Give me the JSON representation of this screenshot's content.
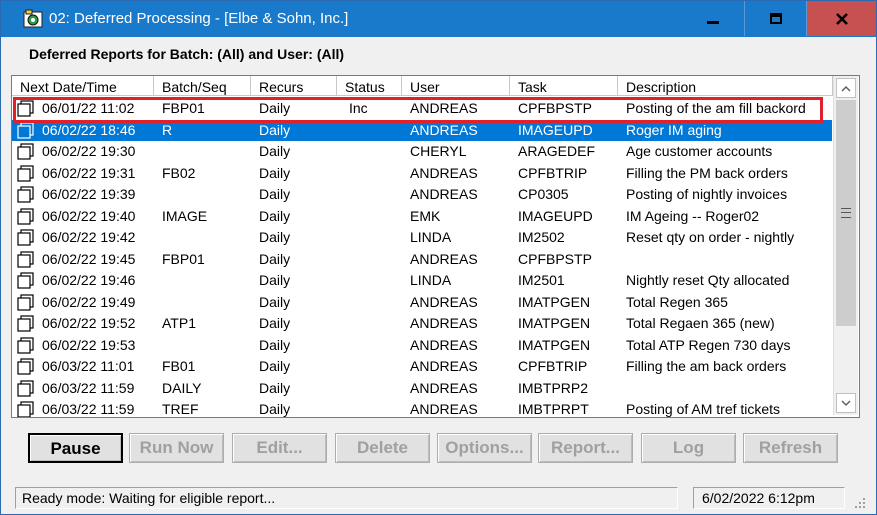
{
  "window": {
    "title": "02: Deferred Processing - [Elbe & Sohn, Inc.]",
    "header_label": "Deferred Reports for Batch:  (All) and User: (All)"
  },
  "columns": [
    "Next Date/Time",
    "Batch/Seq",
    "Recurs",
    "Status",
    "User",
    "Task",
    "Description"
  ],
  "rows": [
    {
      "datetime": "06/01/22 11:02",
      "batch": "FBP01",
      "recurs": "Daily",
      "status": "Inc",
      "user": "ANDREAS",
      "task": "CPFBPSTP",
      "description": "Posting of the am fill backord"
    },
    {
      "datetime": "06/02/22 18:46",
      "batch": "R",
      "recurs": "Daily",
      "status": "",
      "user": "ANDREAS",
      "task": "IMAGEUPD",
      "description": "Roger IM aging"
    },
    {
      "datetime": "06/02/22 19:30",
      "batch": "",
      "recurs": "Daily",
      "status": "",
      "user": "CHERYL",
      "task": "ARAGEDEF",
      "description": "Age customer accounts"
    },
    {
      "datetime": "06/02/22 19:31",
      "batch": "FB02",
      "recurs": "Daily",
      "status": "",
      "user": "ANDREAS",
      "task": "CPFBTRIP",
      "description": "Filling the PM back orders"
    },
    {
      "datetime": "06/02/22 19:39",
      "batch": "",
      "recurs": "Daily",
      "status": "",
      "user": "ANDREAS",
      "task": "CP0305",
      "description": "Posting of nightly invoices"
    },
    {
      "datetime": "06/02/22 19:40",
      "batch": "IMAGE",
      "recurs": "Daily",
      "status": "",
      "user": "EMK",
      "task": "IMAGEUPD",
      "description": "IM Ageing -- Roger02"
    },
    {
      "datetime": "06/02/22 19:42",
      "batch": "",
      "recurs": "Daily",
      "status": "",
      "user": "LINDA",
      "task": "IM2502",
      "description": "Reset qty on order - nightly"
    },
    {
      "datetime": "06/02/22 19:45",
      "batch": "FBP01",
      "recurs": "Daily",
      "status": "",
      "user": "ANDREAS",
      "task": "CPFBPSTP",
      "description": ""
    },
    {
      "datetime": "06/02/22 19:46",
      "batch": "",
      "recurs": "Daily",
      "status": "",
      "user": "LINDA",
      "task": "IM2501",
      "description": "Nightly reset Qty allocated"
    },
    {
      "datetime": "06/02/22 19:49",
      "batch": "",
      "recurs": "Daily",
      "status": "",
      "user": "ANDREAS",
      "task": "IMATPGEN",
      "description": "Total Regen 365"
    },
    {
      "datetime": "06/02/22 19:52",
      "batch": "ATP1",
      "recurs": "Daily",
      "status": "",
      "user": "ANDREAS",
      "task": "IMATPGEN",
      "description": "Total Regaen 365 (new)"
    },
    {
      "datetime": "06/02/22 19:53",
      "batch": "",
      "recurs": "Daily",
      "status": "",
      "user": "ANDREAS",
      "task": "IMATPGEN",
      "description": "Total ATP Regen 730 days"
    },
    {
      "datetime": "06/03/22 11:01",
      "batch": "FB01",
      "recurs": "Daily",
      "status": "",
      "user": "ANDREAS",
      "task": "CPFBTRIP",
      "description": "Filling the am back orders"
    },
    {
      "datetime": "06/03/22 11:59",
      "batch": "DAILY",
      "recurs": "Daily",
      "status": "",
      "user": "ANDREAS",
      "task": "IMBTPRP2",
      "description": ""
    },
    {
      "datetime": "06/03/22 11:59",
      "batch": "TREF",
      "recurs": "Daily",
      "status": "",
      "user": "ANDREAS",
      "task": "IMBTPRPT",
      "description": "Posting of AM tref tickets"
    }
  ],
  "selected_row": 1,
  "buttons": [
    {
      "label": "Pause",
      "enabled": true
    },
    {
      "label": "Run Now",
      "enabled": false
    },
    {
      "label": "Edit...",
      "enabled": false
    },
    {
      "label": "Delete",
      "enabled": false
    },
    {
      "label": "Options...",
      "enabled": false
    },
    {
      "label": "Report...",
      "enabled": false
    },
    {
      "label": "Log",
      "enabled": false
    },
    {
      "label": "Refresh",
      "enabled": false
    }
  ],
  "status": {
    "message": "Ready mode: Waiting for eligible report...",
    "datetime": "6/02/2022  6:12pm"
  },
  "colors": {
    "titlebar": "#1979ca",
    "selection": "#0078d7",
    "highlight_box": "#e0202a",
    "close_button": "#c75050"
  }
}
